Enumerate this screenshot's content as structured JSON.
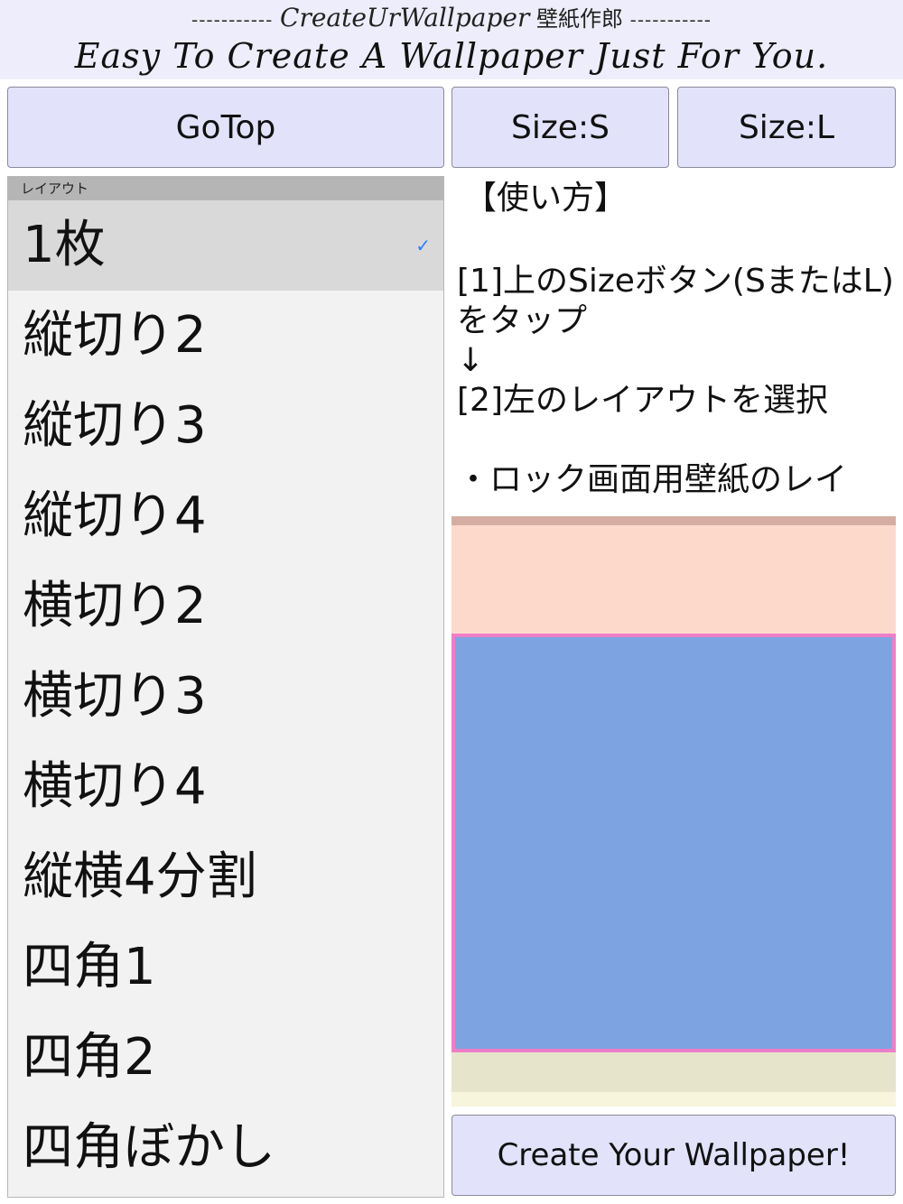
{
  "header": {
    "dash_left": "-----------",
    "brand": "CreateUrWallpaper",
    "app_name_ja": "壁紙作郎",
    "dash_right": "-----------",
    "tagline": "Easy To Create A Wallpaper Just For You."
  },
  "toolbar": {
    "gotop_label": "GoTop",
    "size_s_label": "Size:S",
    "size_l_label": "Size:L"
  },
  "layout_list": {
    "header": "レイアウト",
    "selected_index": 0,
    "items": [
      {
        "label": "1枚"
      },
      {
        "label": "縦切り2"
      },
      {
        "label": "縦切り3"
      },
      {
        "label": "縦切り4"
      },
      {
        "label": "横切り2"
      },
      {
        "label": "横切り3"
      },
      {
        "label": "横切り4"
      },
      {
        "label": "縦横4分割"
      },
      {
        "label": "四角1"
      },
      {
        "label": "四角2"
      },
      {
        "label": "四角ぼかし"
      }
    ],
    "check_icon": "✓"
  },
  "instructions": {
    "title": "【使い方】",
    "step1": "[1]上のSizeボタン(SまたはL)をタップ",
    "arrow": "↓",
    "step2": "[2]左のレイアウトを選択",
    "note": "・ロック画面用壁紙のレイ"
  },
  "preview": {
    "colors": {
      "top_dark": "#d5ada2",
      "top": "#fdd9cc",
      "square": "#7da4e1",
      "square_border": "#ec7fc7",
      "bottom": "#e6e4cb",
      "bottom_light": "#f8f5dd"
    }
  },
  "actions": {
    "create_label": "Create Your Wallpaper!"
  },
  "colors": {
    "header_bg": "#ededfb",
    "button_bg": "#e2e2fb",
    "list_bg": "#f2f2f2",
    "selected_bg": "#d9d9d9",
    "check": "#2f7df6"
  }
}
